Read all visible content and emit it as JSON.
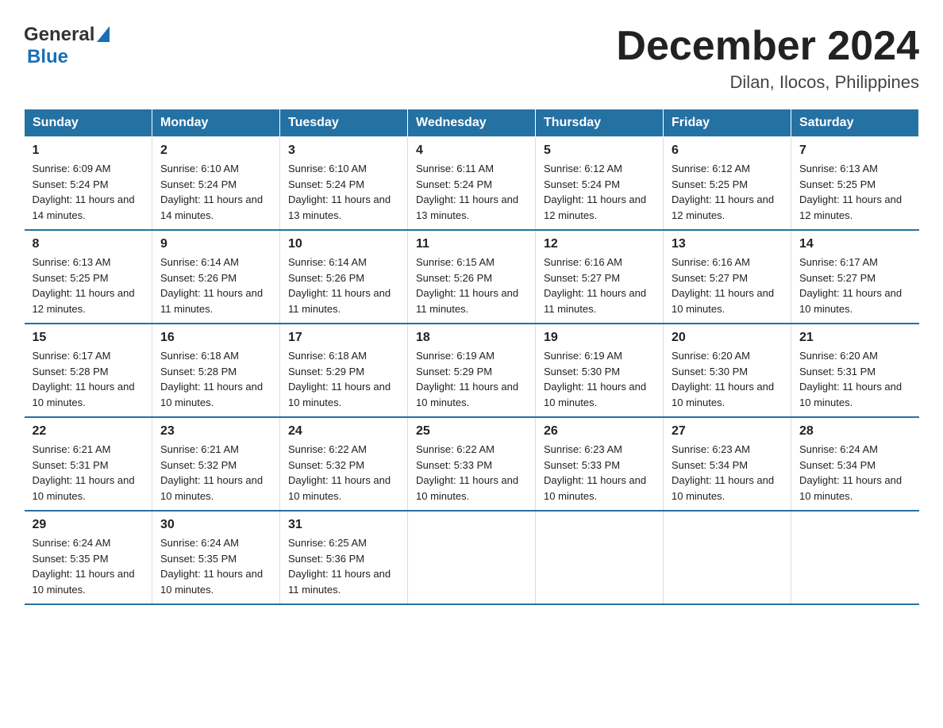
{
  "header": {
    "logo_general": "General",
    "logo_blue": "Blue",
    "month_title": "December 2024",
    "location": "Dilan, Ilocos, Philippines"
  },
  "days_of_week": [
    "Sunday",
    "Monday",
    "Tuesday",
    "Wednesday",
    "Thursday",
    "Friday",
    "Saturday"
  ],
  "weeks": [
    [
      {
        "day": "1",
        "sunrise": "6:09 AM",
        "sunset": "5:24 PM",
        "daylight": "11 hours and 14 minutes."
      },
      {
        "day": "2",
        "sunrise": "6:10 AM",
        "sunset": "5:24 PM",
        "daylight": "11 hours and 14 minutes."
      },
      {
        "day": "3",
        "sunrise": "6:10 AM",
        "sunset": "5:24 PM",
        "daylight": "11 hours and 13 minutes."
      },
      {
        "day": "4",
        "sunrise": "6:11 AM",
        "sunset": "5:24 PM",
        "daylight": "11 hours and 13 minutes."
      },
      {
        "day": "5",
        "sunrise": "6:12 AM",
        "sunset": "5:24 PM",
        "daylight": "11 hours and 12 minutes."
      },
      {
        "day": "6",
        "sunrise": "6:12 AM",
        "sunset": "5:25 PM",
        "daylight": "11 hours and 12 minutes."
      },
      {
        "day": "7",
        "sunrise": "6:13 AM",
        "sunset": "5:25 PM",
        "daylight": "11 hours and 12 minutes."
      }
    ],
    [
      {
        "day": "8",
        "sunrise": "6:13 AM",
        "sunset": "5:25 PM",
        "daylight": "11 hours and 12 minutes."
      },
      {
        "day": "9",
        "sunrise": "6:14 AM",
        "sunset": "5:26 PM",
        "daylight": "11 hours and 11 minutes."
      },
      {
        "day": "10",
        "sunrise": "6:14 AM",
        "sunset": "5:26 PM",
        "daylight": "11 hours and 11 minutes."
      },
      {
        "day": "11",
        "sunrise": "6:15 AM",
        "sunset": "5:26 PM",
        "daylight": "11 hours and 11 minutes."
      },
      {
        "day": "12",
        "sunrise": "6:16 AM",
        "sunset": "5:27 PM",
        "daylight": "11 hours and 11 minutes."
      },
      {
        "day": "13",
        "sunrise": "6:16 AM",
        "sunset": "5:27 PM",
        "daylight": "11 hours and 10 minutes."
      },
      {
        "day": "14",
        "sunrise": "6:17 AM",
        "sunset": "5:27 PM",
        "daylight": "11 hours and 10 minutes."
      }
    ],
    [
      {
        "day": "15",
        "sunrise": "6:17 AM",
        "sunset": "5:28 PM",
        "daylight": "11 hours and 10 minutes."
      },
      {
        "day": "16",
        "sunrise": "6:18 AM",
        "sunset": "5:28 PM",
        "daylight": "11 hours and 10 minutes."
      },
      {
        "day": "17",
        "sunrise": "6:18 AM",
        "sunset": "5:29 PM",
        "daylight": "11 hours and 10 minutes."
      },
      {
        "day": "18",
        "sunrise": "6:19 AM",
        "sunset": "5:29 PM",
        "daylight": "11 hours and 10 minutes."
      },
      {
        "day": "19",
        "sunrise": "6:19 AM",
        "sunset": "5:30 PM",
        "daylight": "11 hours and 10 minutes."
      },
      {
        "day": "20",
        "sunrise": "6:20 AM",
        "sunset": "5:30 PM",
        "daylight": "11 hours and 10 minutes."
      },
      {
        "day": "21",
        "sunrise": "6:20 AM",
        "sunset": "5:31 PM",
        "daylight": "11 hours and 10 minutes."
      }
    ],
    [
      {
        "day": "22",
        "sunrise": "6:21 AM",
        "sunset": "5:31 PM",
        "daylight": "11 hours and 10 minutes."
      },
      {
        "day": "23",
        "sunrise": "6:21 AM",
        "sunset": "5:32 PM",
        "daylight": "11 hours and 10 minutes."
      },
      {
        "day": "24",
        "sunrise": "6:22 AM",
        "sunset": "5:32 PM",
        "daylight": "11 hours and 10 minutes."
      },
      {
        "day": "25",
        "sunrise": "6:22 AM",
        "sunset": "5:33 PM",
        "daylight": "11 hours and 10 minutes."
      },
      {
        "day": "26",
        "sunrise": "6:23 AM",
        "sunset": "5:33 PM",
        "daylight": "11 hours and 10 minutes."
      },
      {
        "day": "27",
        "sunrise": "6:23 AM",
        "sunset": "5:34 PM",
        "daylight": "11 hours and 10 minutes."
      },
      {
        "day": "28",
        "sunrise": "6:24 AM",
        "sunset": "5:34 PM",
        "daylight": "11 hours and 10 minutes."
      }
    ],
    [
      {
        "day": "29",
        "sunrise": "6:24 AM",
        "sunset": "5:35 PM",
        "daylight": "11 hours and 10 minutes."
      },
      {
        "day": "30",
        "sunrise": "6:24 AM",
        "sunset": "5:35 PM",
        "daylight": "11 hours and 10 minutes."
      },
      {
        "day": "31",
        "sunrise": "6:25 AM",
        "sunset": "5:36 PM",
        "daylight": "11 hours and 11 minutes."
      },
      null,
      null,
      null,
      null
    ]
  ],
  "labels": {
    "sunrise": "Sunrise:",
    "sunset": "Sunset:",
    "daylight": "Daylight:"
  }
}
